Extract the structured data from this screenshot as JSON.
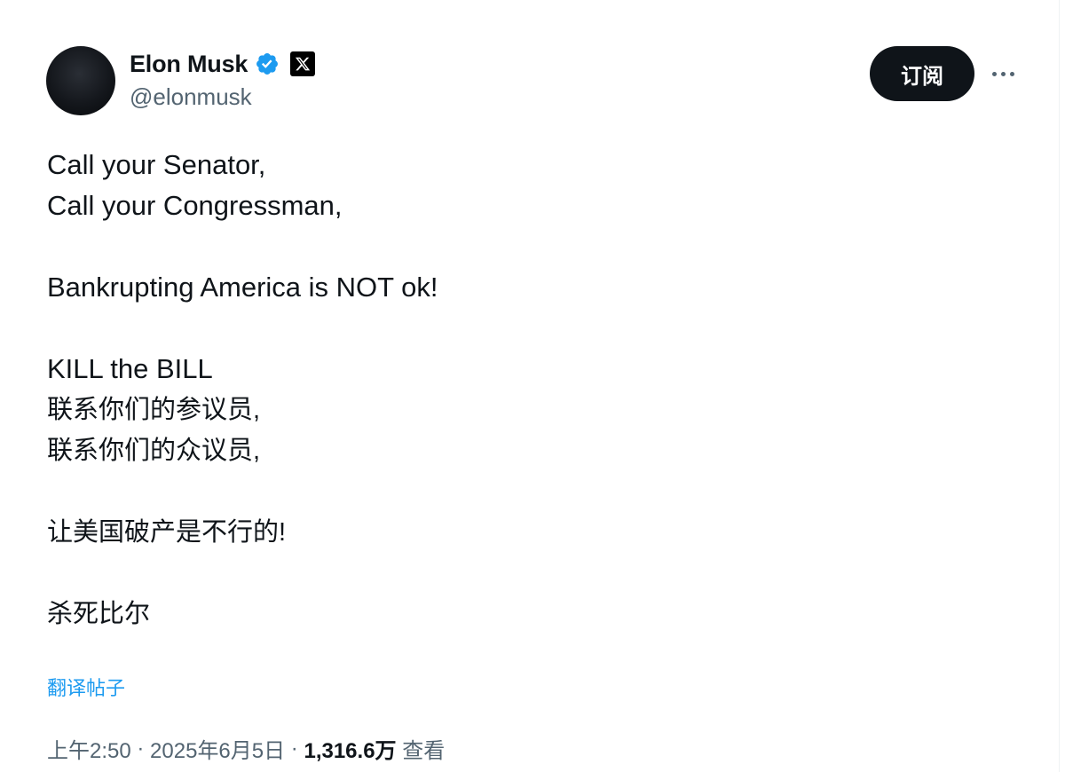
{
  "author": {
    "display_name": "Elon Musk",
    "handle": "@elonmusk"
  },
  "header": {
    "subscribe_label": "订阅"
  },
  "tweet": {
    "lines": [
      "Call your Senator,",
      "Call your Congressman,",
      "",
      "Bankrupting America is NOT ok!",
      "",
      "KILL the BILL",
      "联系你们的参议员,",
      "联系你们的众议员,",
      "",
      "让美国破产是不行的!",
      "",
      "杀死比尔"
    ]
  },
  "translate_label": "翻译帖子",
  "meta": {
    "time": "上午2:50",
    "separator": " · ",
    "date": "2025年6月5日",
    "separator2": " · ",
    "views_count": "1,316.6万",
    "views_label": " 查看"
  },
  "icons": {
    "verified": "verified-badge-icon",
    "affiliate": "x-logo-icon",
    "more": "more-horizontal-icon"
  },
  "colors": {
    "verified_blue": "#1d9bf0",
    "text_primary": "#0f1419",
    "text_secondary": "#536471",
    "link": "#1d9bf0"
  }
}
